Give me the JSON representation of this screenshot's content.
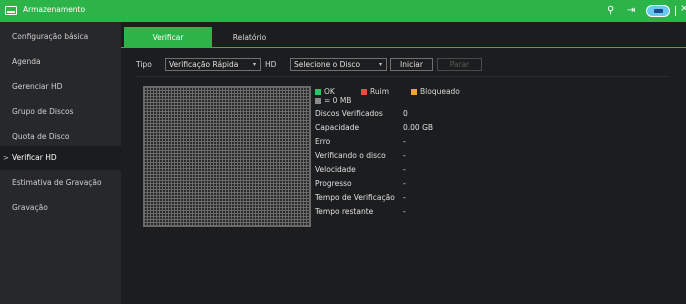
{
  "titlebar": {
    "title": "Armazenamento",
    "icons": [
      "storage-icon",
      "user-icon",
      "exit-icon",
      "status-pill-icon",
      "close-icon"
    ]
  },
  "sidebar": {
    "items": [
      {
        "label": "Configuração básica"
      },
      {
        "label": "Agenda"
      },
      {
        "label": "Gerenciar HD"
      },
      {
        "label": "Grupo de Discos"
      },
      {
        "label": "Quota de Disco"
      },
      {
        "label": "Verificar HD",
        "active": true
      },
      {
        "label": "Estimativa de Gravação"
      },
      {
        "label": "Gravação"
      }
    ]
  },
  "tabs": [
    {
      "label": "Verificar",
      "active": true
    },
    {
      "label": "Relatório"
    }
  ],
  "form": {
    "tipo_label": "Tipo",
    "tipo_value": "Verificação Rápida",
    "hd_label": "HD",
    "hd_value": "Selecione o Disco",
    "start_label": "Iniciar",
    "stop_label": "Parar"
  },
  "legend": {
    "ok": "OK",
    "ruim": "Ruim",
    "bloqueado": "Bloqueado",
    "unit": "= 0 MB",
    "colors": {
      "ok": "#2cc46a",
      "ruim": "#e84c3d",
      "bloqueado": "#f5a623",
      "unit": "#8a8a8a"
    }
  },
  "info": [
    {
      "label": "Discos Verificados",
      "value": "0"
    },
    {
      "label": "Capacidade",
      "value": "0.00 GB"
    },
    {
      "label": "Erro",
      "value": "-"
    },
    {
      "label": "Verificando o disco",
      "value": "-"
    },
    {
      "label": "Velocidade",
      "value": "-"
    },
    {
      "label": "Progresso",
      "value": "-"
    },
    {
      "label": "Tempo de Verificação",
      "value": "-"
    },
    {
      "label": "Tempo restante",
      "value": "-"
    }
  ],
  "colors": {
    "accent": "#2cb449"
  }
}
